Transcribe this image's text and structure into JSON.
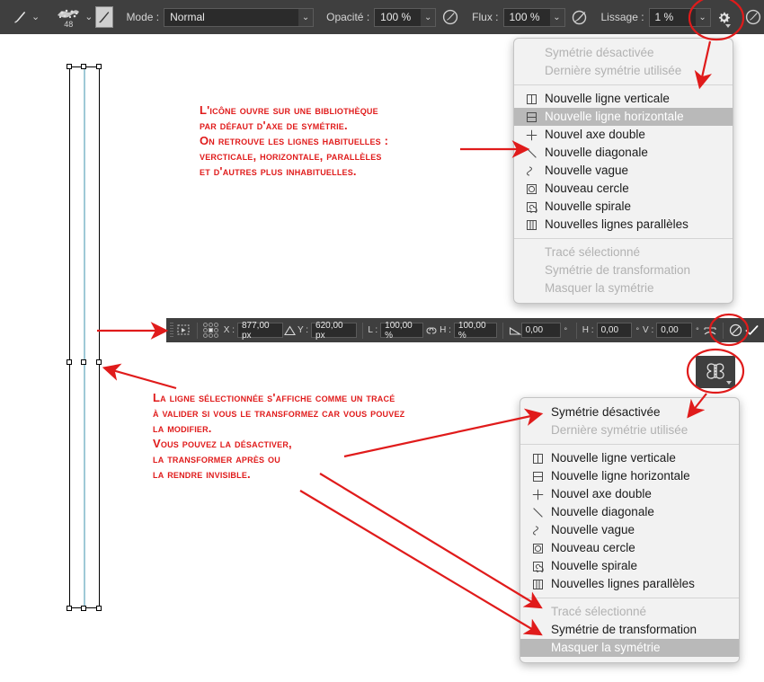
{
  "app": {
    "name": "Photoshop symmetry tool annotated screenshot",
    "accent_red": "#e01b1b",
    "bar_bg": "#3f3f3f",
    "menu_bg": "#f2f2f2",
    "highlight_bg": "#b9b9b9",
    "path_cyan": "#9fc9d6"
  },
  "options_bar": {
    "brush_tool_icon": "brush-icon",
    "brush_tool_caret": "chevron-down-icon",
    "brush_preset_icon": "brush-tip-icon",
    "brush_size": "48",
    "brush_preset_caret": "chevron-down-icon",
    "brush_panel_icon": "brush-panel-icon",
    "mode_label": "Mode :",
    "mode_value": "Normal",
    "mode_caret": "chevron-down-icon",
    "opacity_label": "Opacité :",
    "opacity_value": "100 %",
    "opacity_caret": "chevron-down-icon",
    "opacity_pressure_icon": "pressure-opacity-icon",
    "flow_label": "Flux :",
    "flow_value": "100 %",
    "flow_caret": "chevron-down-icon",
    "airbrush_icon": "airbrush-icon",
    "smoothing_label": "Lissage :",
    "smoothing_value": "1 %",
    "smoothing_caret": "chevron-down-icon",
    "smoothing_options_icon": "gear-icon",
    "angle_pressure_icon": "pressure-size-icon",
    "symmetry_icon": "butterfly-symmetry-icon"
  },
  "transform_bar": {
    "reference_point_icon": "reference-point-icon",
    "ref_grid_icon": "anchor-grid-icon",
    "x_label": "X :",
    "x_value": "877,00 px",
    "delta_icon": "delta-triangle-icon",
    "y_label": "Y :",
    "y_value": "620,00 px",
    "w_label": "L :",
    "w_value": "100,00 %",
    "link_icon": "chain-link-icon",
    "h_label": "H :",
    "h_value": "100,00 %",
    "rotate_icon": "rotate-angle-icon",
    "rotate_value": "0,00",
    "rotate_unit": "°",
    "skew_h_label": "H :",
    "skew_h_value": "0,00",
    "skew_h_unit": "°",
    "skew_v_label": "V :",
    "skew_v_value": "0,00",
    "skew_v_unit": "°",
    "warp_icon": "warp-mode-icon",
    "cancel_icon": "cancel-transform-icon",
    "commit_icon": "commit-transform-icon"
  },
  "symmetry_menu": {
    "top": {
      "header_items": [
        {
          "label": "Symétrie désactivée",
          "state": "disabled",
          "icon": "none"
        },
        {
          "label": "Dernière symétrie utilisée",
          "state": "disabled",
          "icon": "none"
        }
      ],
      "line_items": [
        {
          "label": "Nouvelle ligne verticale",
          "state": "normal",
          "icon": "vertical-line-icon"
        },
        {
          "label": "Nouvelle ligne horizontale",
          "state": "highlighted",
          "icon": "horizontal-line-icon"
        },
        {
          "label": "Nouvel axe double",
          "state": "normal",
          "icon": "dual-axis-icon"
        },
        {
          "label": "Nouvelle diagonale",
          "state": "normal",
          "icon": "diagonal-line-icon"
        },
        {
          "label": "Nouvelle vague",
          "state": "normal",
          "icon": "wave-icon"
        },
        {
          "label": "Nouveau cercle",
          "state": "normal",
          "icon": "circle-icon"
        },
        {
          "label": "Nouvelle spirale",
          "state": "normal",
          "icon": "spiral-icon"
        },
        {
          "label": "Nouvelles lignes parallèles",
          "state": "normal",
          "icon": "parallel-lines-icon"
        }
      ],
      "footer_items": [
        {
          "label": "Tracé sélectionné",
          "state": "disabled",
          "icon": "none"
        },
        {
          "label": "Symétrie de transformation",
          "state": "disabled",
          "icon": "none"
        },
        {
          "label": "Masquer la symétrie",
          "state": "disabled",
          "icon": "none"
        }
      ]
    },
    "bottom": {
      "header_items": [
        {
          "label": "Symétrie désactivée",
          "state": "normal",
          "icon": "none"
        },
        {
          "label": "Dernière symétrie utilisée",
          "state": "disabled",
          "icon": "none"
        }
      ],
      "line_items": [
        {
          "label": "Nouvelle ligne verticale",
          "state": "normal",
          "icon": "vertical-line-icon"
        },
        {
          "label": "Nouvelle ligne horizontale",
          "state": "normal",
          "icon": "horizontal-line-icon"
        },
        {
          "label": "Nouvel axe double",
          "state": "normal",
          "icon": "dual-axis-icon"
        },
        {
          "label": "Nouvelle diagonale",
          "state": "normal",
          "icon": "diagonal-line-icon"
        },
        {
          "label": "Nouvelle vague",
          "state": "normal",
          "icon": "wave-icon"
        },
        {
          "label": "Nouveau cercle",
          "state": "normal",
          "icon": "circle-icon"
        },
        {
          "label": "Nouvelle spirale",
          "state": "normal",
          "icon": "spiral-icon"
        },
        {
          "label": "Nouvelles lignes parallèles",
          "state": "normal",
          "icon": "parallel-lines-icon"
        }
      ],
      "footer_items": [
        {
          "label": "Tracé sélectionné",
          "state": "disabled",
          "icon": "none"
        },
        {
          "label": "Symétrie de transformation",
          "state": "normal",
          "icon": "none"
        },
        {
          "label": "Masquer la symétrie",
          "state": "highlighted",
          "icon": "none"
        }
      ]
    }
  },
  "annotations": {
    "top_note": "L'icône ouvre sur une bibliothèque\npar défaut d'axe de symétrie.\nOn retrouve les lignes habituelles :\nvercticale, horizontale, parallèles\net d'autres plus inhabituelles.",
    "bottom_note": "La ligne sélectionnée s'affiche comme un tracé\nà valider si vous le transformez car vous pouvez\nla modifier.\nVous pouvez la désactiver,\nla transformer après ou\nla rendre invisible."
  },
  "canvas": {
    "path_description": "selected-symmetry-path",
    "line_color": "#000000",
    "guide_color": "#9fc9d6"
  }
}
